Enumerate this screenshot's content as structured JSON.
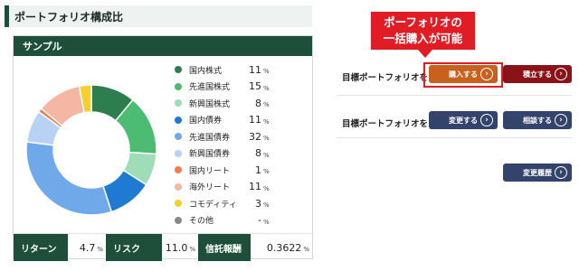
{
  "page": {
    "title": "ポートフォリオ構成比"
  },
  "panel": {
    "header": "サンプル"
  },
  "allocation": [
    {
      "label": "国内株式",
      "value": "11",
      "num": 11,
      "color": "#2e7d4f"
    },
    {
      "label": "先進国株式",
      "value": "15",
      "num": 15,
      "color": "#4cbc73"
    },
    {
      "label": "新興国株式",
      "value": "8",
      "num": 8,
      "color": "#9fdcb8"
    },
    {
      "label": "国内債券",
      "value": "11",
      "num": 11,
      "color": "#1f7bd1"
    },
    {
      "label": "先進国債券",
      "value": "32",
      "num": 32,
      "color": "#6fa9ea"
    },
    {
      "label": "新興国債券",
      "value": "8",
      "num": 8,
      "color": "#b7d2f2"
    },
    {
      "label": "国内リート",
      "value": "1",
      "num": 1,
      "color": "#f07c4f"
    },
    {
      "label": "海外リート",
      "value": "11",
      "num": 11,
      "color": "#f5b6a3"
    },
    {
      "label": "コモディティ",
      "value": "3",
      "num": 3,
      "color": "#f6cf2a"
    },
    {
      "label": "その他",
      "value": "-",
      "num": 0,
      "color": "#8a8a8a"
    }
  ],
  "unit": "%",
  "stats": {
    "return_label": "リターン",
    "return_value": "4.7",
    "risk_label": "リスク",
    "risk_value": "11.0",
    "fee_label": "信託報酬",
    "fee_value": "0.3622"
  },
  "callout": {
    "line1": "ポーフォリオの",
    "line2": "一括購入が可能"
  },
  "actions": {
    "row1_label": "目標ポートフォリオを",
    "buy": "購入する",
    "accumulate": "積立する",
    "row2_label": "目標ポートフォリオを",
    "change": "変更する",
    "consult": "相談する",
    "history": "変更履歴",
    "chevron": "›"
  },
  "colors": {
    "brand": "#1d4f3a",
    "accent": "#e21c24",
    "buy": "#c9601d",
    "accumulate": "#8a1319",
    "navy": "#33436b"
  }
}
